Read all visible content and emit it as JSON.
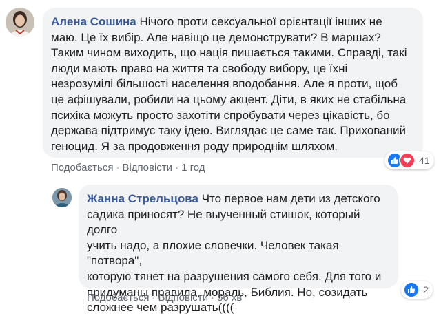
{
  "comments": [
    {
      "author": "Алена Сошина",
      "text": "Нічого проти сексуальної орієнтації інших не\nмаю. Це їх вибір. Але навіщо це демонструвати? В маршах?\nТаким чином виходить, що нація пишається такими. Справді, такі\nлюди мають право на життя та свободу вибору, це їхні\nнезрозумілі більшості населення вподобання. Але я проти, щоб\nце афішували, робили на цьому акцент. Діти, в яких не стабільна\nпсихіка можуть просто захотіти спробувати через цікавість, бо\nдержава підтримує таку ідею. Виглядає це саме так. Прихований\nгеноцид. Я за продовження роду природнім шляхом.",
      "like_label": "Подобається",
      "reply_label": "Відповісти",
      "time": "1 год",
      "reaction_count": "41",
      "reactions": [
        "like-icon",
        "love-icon"
      ]
    },
    {
      "author": "Жанна Стрельцова",
      "text": "Что первое нам дети из детского\nсадика приносят? Не выученный стишок, который долго\nучить надо, а плохие словечки. Человек такая \"потвора\",\nкоторую тянет на разрушения самого себя. Для того и\nпридуманы правила, мораль, Библия. Но, созидать\nсложнее чем разрушать((((",
      "like_label": "Подобається",
      "reply_label": "Відповісти",
      "time": "56 хв",
      "reaction_count": "2",
      "reactions": [
        "like-icon"
      ]
    }
  ],
  "colors": {
    "author_name": "#385898",
    "bubble_bg": "#f2f3f5",
    "like_blue": "#1877f2",
    "love_red": "#f33e58",
    "meta_gray": "#606770"
  }
}
